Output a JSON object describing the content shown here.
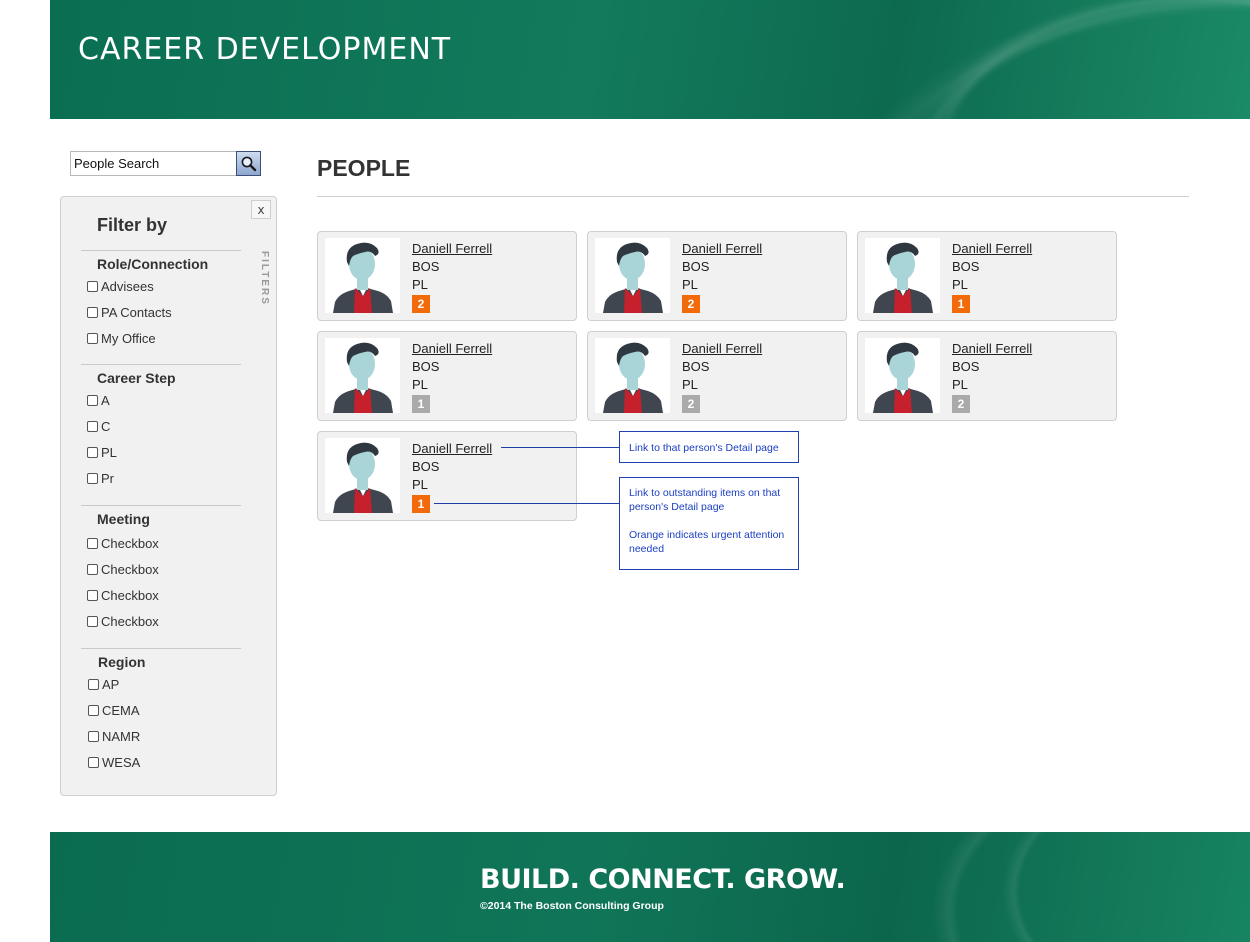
{
  "header": {
    "title": "CAREER DEVELOPMENT"
  },
  "search": {
    "placeholder": "People Search",
    "icon": "search-icon"
  },
  "filters": {
    "title": "Filter by",
    "close_label": "x",
    "side_label": "FILTERS",
    "sections": [
      {
        "title": "Role/Connection",
        "options": [
          "Advisees",
          "PA Contacts",
          "My Office"
        ]
      },
      {
        "title": "Career Step",
        "options": [
          "A",
          "C",
          "PL",
          "Pr"
        ]
      },
      {
        "title": "Meeting",
        "options": [
          "Checkbox",
          "Checkbox",
          "Checkbox",
          "Checkbox"
        ]
      },
      {
        "title": "Region",
        "options": [
          "AP",
          "CEMA",
          "NAMR",
          "WESA"
        ]
      }
    ]
  },
  "main": {
    "title": "PEOPLE",
    "people": [
      {
        "name": "Daniell  Ferrell",
        "office": "BOS",
        "step": "PL",
        "count": "2",
        "urgent": true
      },
      {
        "name": "Daniell  Ferrell",
        "office": "BOS",
        "step": "PL",
        "count": "2",
        "urgent": true
      },
      {
        "name": "Daniell  Ferrell",
        "office": "BOS",
        "step": "PL",
        "count": "1",
        "urgent": true
      },
      {
        "name": "Daniell  Ferrell",
        "office": "BOS",
        "step": "PL",
        "count": "1",
        "urgent": false
      },
      {
        "name": "Daniell  Ferrell",
        "office": "BOS",
        "step": "PL",
        "count": "2",
        "urgent": false
      },
      {
        "name": "Daniell  Ferrell",
        "office": "BOS",
        "step": "PL",
        "count": "2",
        "urgent": false
      },
      {
        "name": "Daniell  Ferrell",
        "office": "BOS",
        "step": "PL",
        "count": "1",
        "urgent": true
      }
    ],
    "colors": {
      "urgent": "#f26a0a",
      "normal": "#aaaaaa"
    }
  },
  "annotations": {
    "link_note": "Link to that person's Detail page",
    "items_note_1": "Link to outstanding items on that person's Detail page",
    "items_note_2": "Orange indicates urgent attention needed"
  },
  "footer": {
    "tagline": "BUILD. CONNECT. GROW.",
    "copyright": "©2014 The Boston Consulting Group"
  }
}
